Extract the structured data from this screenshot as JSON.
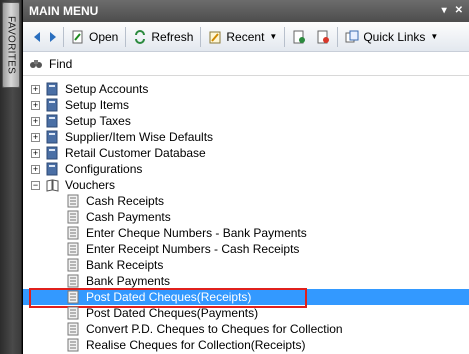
{
  "rail": {
    "favorites_label": "FAVORITES"
  },
  "panel": {
    "title": "MAIN MENU",
    "toolbar": {
      "open_label": "Open",
      "refresh_label": "Refresh",
      "recent_label": "Recent",
      "quick_links_label": "Quick Links"
    },
    "find_label": "Find"
  },
  "tree": {
    "roots": [
      {
        "label": "Setup Accounts",
        "expander": "+"
      },
      {
        "label": "Setup Items",
        "expander": "+"
      },
      {
        "label": "Setup Taxes",
        "expander": "+"
      },
      {
        "label": "Supplier/Item Wise Defaults",
        "expander": "+"
      },
      {
        "label": "Retail Customer Database",
        "expander": "+"
      },
      {
        "label": "Configurations",
        "expander": "+"
      },
      {
        "label": "Vouchers",
        "expander": "−"
      }
    ],
    "vouchers_children": [
      {
        "label": "Cash Receipts"
      },
      {
        "label": "Cash Payments"
      },
      {
        "label": "Enter Cheque Numbers - Bank Payments"
      },
      {
        "label": "Enter Receipt Numbers - Cash Receipts"
      },
      {
        "label": "Bank Receipts"
      },
      {
        "label": "Bank Payments"
      },
      {
        "label": "Post Dated Cheques(Receipts)"
      },
      {
        "label": "Post Dated Cheques(Payments)"
      },
      {
        "label": "Convert P.D. Cheques to Cheques for Collection"
      },
      {
        "label": "Realise Cheques for Collection(Receipts)"
      }
    ]
  }
}
